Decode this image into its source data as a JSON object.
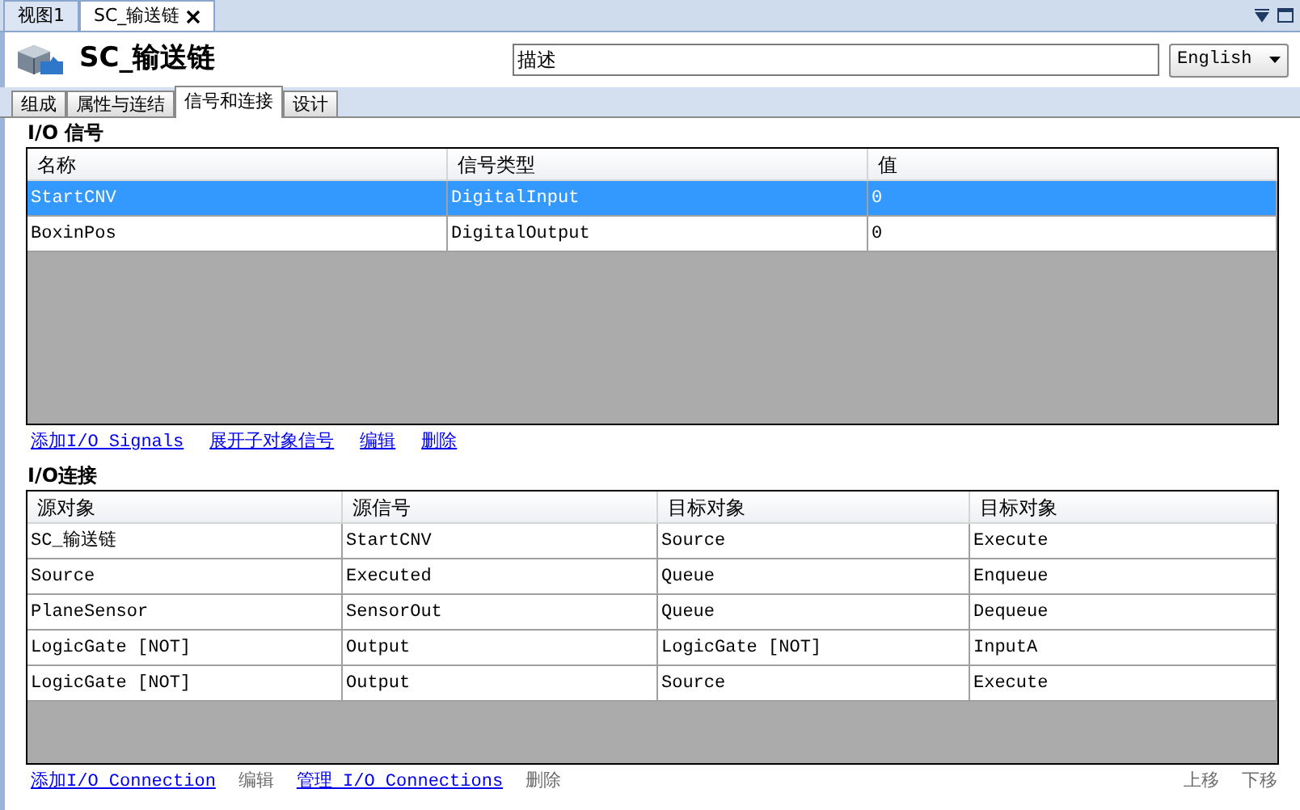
{
  "doc_tabs": [
    {
      "label": "视图1",
      "selected": false,
      "closable": false
    },
    {
      "label": "SC_输送链",
      "selected": true,
      "closable": true
    }
  ],
  "title": "SC_输送链",
  "description": {
    "placeholder": "描述"
  },
  "language": {
    "value": "English"
  },
  "tabs": [
    {
      "label": "组成",
      "selected": false
    },
    {
      "label": "属性与连结",
      "selected": false
    },
    {
      "label": "信号和连接",
      "selected": true
    },
    {
      "label": "设计",
      "selected": false
    }
  ],
  "io_signals": {
    "title": "I/O 信号",
    "columns": [
      "名称",
      "信号类型",
      "值"
    ],
    "rows": [
      {
        "cells": [
          "StartCNV",
          "DigitalInput",
          "0"
        ],
        "selected": true
      },
      {
        "cells": [
          "BoxinPos",
          "DigitalOutput",
          "0"
        ],
        "selected": false
      }
    ],
    "actions": [
      {
        "label": "添加I/O Signals",
        "disabled": false
      },
      {
        "label": "展开子对象信号",
        "disabled": false
      },
      {
        "label": "编辑",
        "disabled": false
      },
      {
        "label": "删除",
        "disabled": false
      }
    ]
  },
  "io_connections": {
    "title": "I/O连接",
    "columns": [
      "源对象",
      "源信号",
      "目标对象",
      "目标对象"
    ],
    "rows": [
      {
        "cells": [
          "SC_输送链",
          "StartCNV",
          "Source",
          "Execute"
        ],
        "selected": false
      },
      {
        "cells": [
          "Source",
          "Executed",
          "Queue",
          "Enqueue"
        ],
        "selected": false
      },
      {
        "cells": [
          "PlaneSensor",
          "SensorOut",
          "Queue",
          "Dequeue"
        ],
        "selected": false
      },
      {
        "cells": [
          "LogicGate [NOT]",
          "Output",
          "LogicGate [NOT]",
          "InputA"
        ],
        "selected": false
      },
      {
        "cells": [
          "LogicGate [NOT]",
          "Output",
          "Source",
          "Execute"
        ],
        "selected": false
      }
    ],
    "actions": [
      {
        "label": "添加I/O Connection",
        "disabled": false
      },
      {
        "label": "编辑",
        "disabled": true
      },
      {
        "label": "管理 I/O Connections",
        "disabled": false
      },
      {
        "label": "删除",
        "disabled": true
      }
    ],
    "move_actions": [
      {
        "label": "上移",
        "disabled": true
      },
      {
        "label": "下移",
        "disabled": true
      }
    ]
  }
}
